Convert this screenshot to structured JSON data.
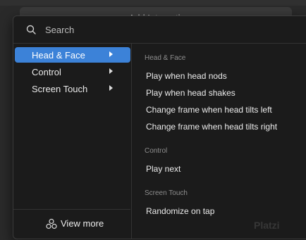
{
  "background": {
    "button_label": "+ Add Interaction"
  },
  "search": {
    "placeholder": "Search",
    "value": ""
  },
  "sidebar": {
    "items": [
      {
        "label": "Head & Face",
        "active": true
      },
      {
        "label": "Control",
        "active": false
      },
      {
        "label": "Screen Touch",
        "active": false
      }
    ],
    "view_more_label": "View more"
  },
  "content": {
    "groups": [
      {
        "header": "Head & Face",
        "actions": [
          "Play when head nods",
          "Play when head shakes",
          "Change frame when head tilts left",
          "Change frame when head tilts right"
        ]
      },
      {
        "header": "Control",
        "actions": [
          "Play next"
        ]
      },
      {
        "header": "Screen Touch",
        "actions": [
          "Randomize on tap"
        ]
      }
    ]
  },
  "watermark": "Platzi",
  "colors": {
    "accent": "#3c82d8",
    "panel": "#1b1b1b",
    "border": "#333333"
  }
}
